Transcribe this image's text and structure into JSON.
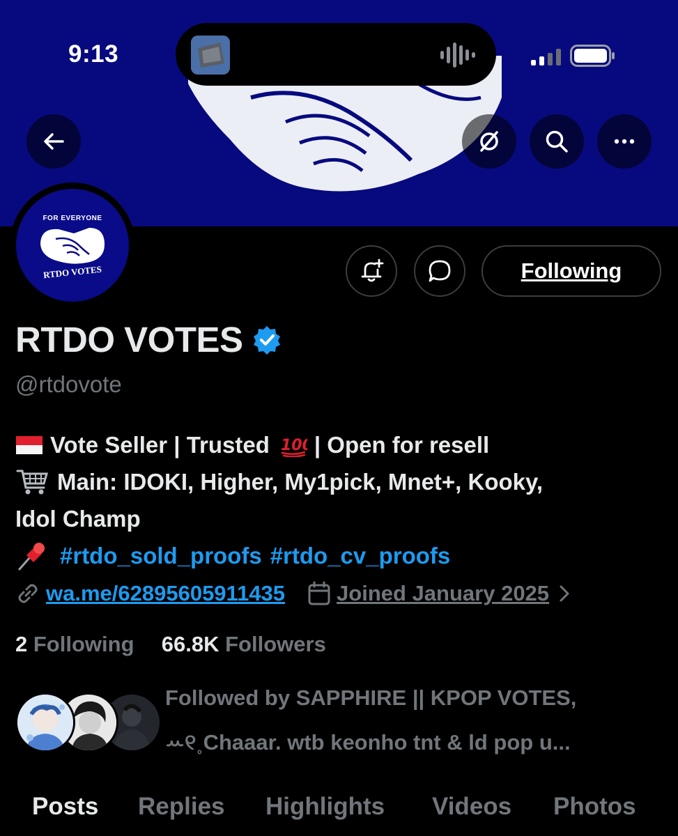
{
  "status_bar": {
    "time": "9:13"
  },
  "profile": {
    "display_name": "RTDO VOTES",
    "handle": "@rtdovote",
    "avatar_top_text": "FOR EVERYONE",
    "avatar_bottom_text": "RTDO VOTES",
    "bio": {
      "line1": "Vote Seller | Trusted",
      "line1_end": "| Open for resell",
      "line2": "Main: IDOKI, Higher, My1pick, Mnet+, Kooky,",
      "line3": "Idol Champ",
      "hashtag1": "#rtdo_sold_proofs",
      "hashtag2": "#rtdo_cv_proofs"
    },
    "link": "wa.me/62895605911435",
    "joined": "Joined January 2025",
    "following_count": "2",
    "following_label": "Following",
    "followers_count": "66.8K",
    "followers_label": "Followers",
    "followed_by_line1": "Followed by SAPPHIRE || KPOP VOTES,",
    "followed_by_line2": "ꕀ୧˳Chaaar. wtb keonho tnt & ld pop u..."
  },
  "actions": {
    "following_button": "Following"
  },
  "tabs": [
    "Posts",
    "Replies",
    "Highlights",
    "Videos",
    "Photos"
  ],
  "icons": [
    "back-arrow-icon",
    "grok-icon",
    "search-icon",
    "more-icon",
    "bell-plus-icon",
    "message-icon",
    "verified-badge-icon",
    "link-icon",
    "calendar-icon",
    "chevron-right-icon"
  ],
  "colors": {
    "banner": "#070a7e",
    "accent": "#1d9bf0",
    "muted": "#71767b",
    "text": "#e7e9ea",
    "background": "#000000"
  }
}
